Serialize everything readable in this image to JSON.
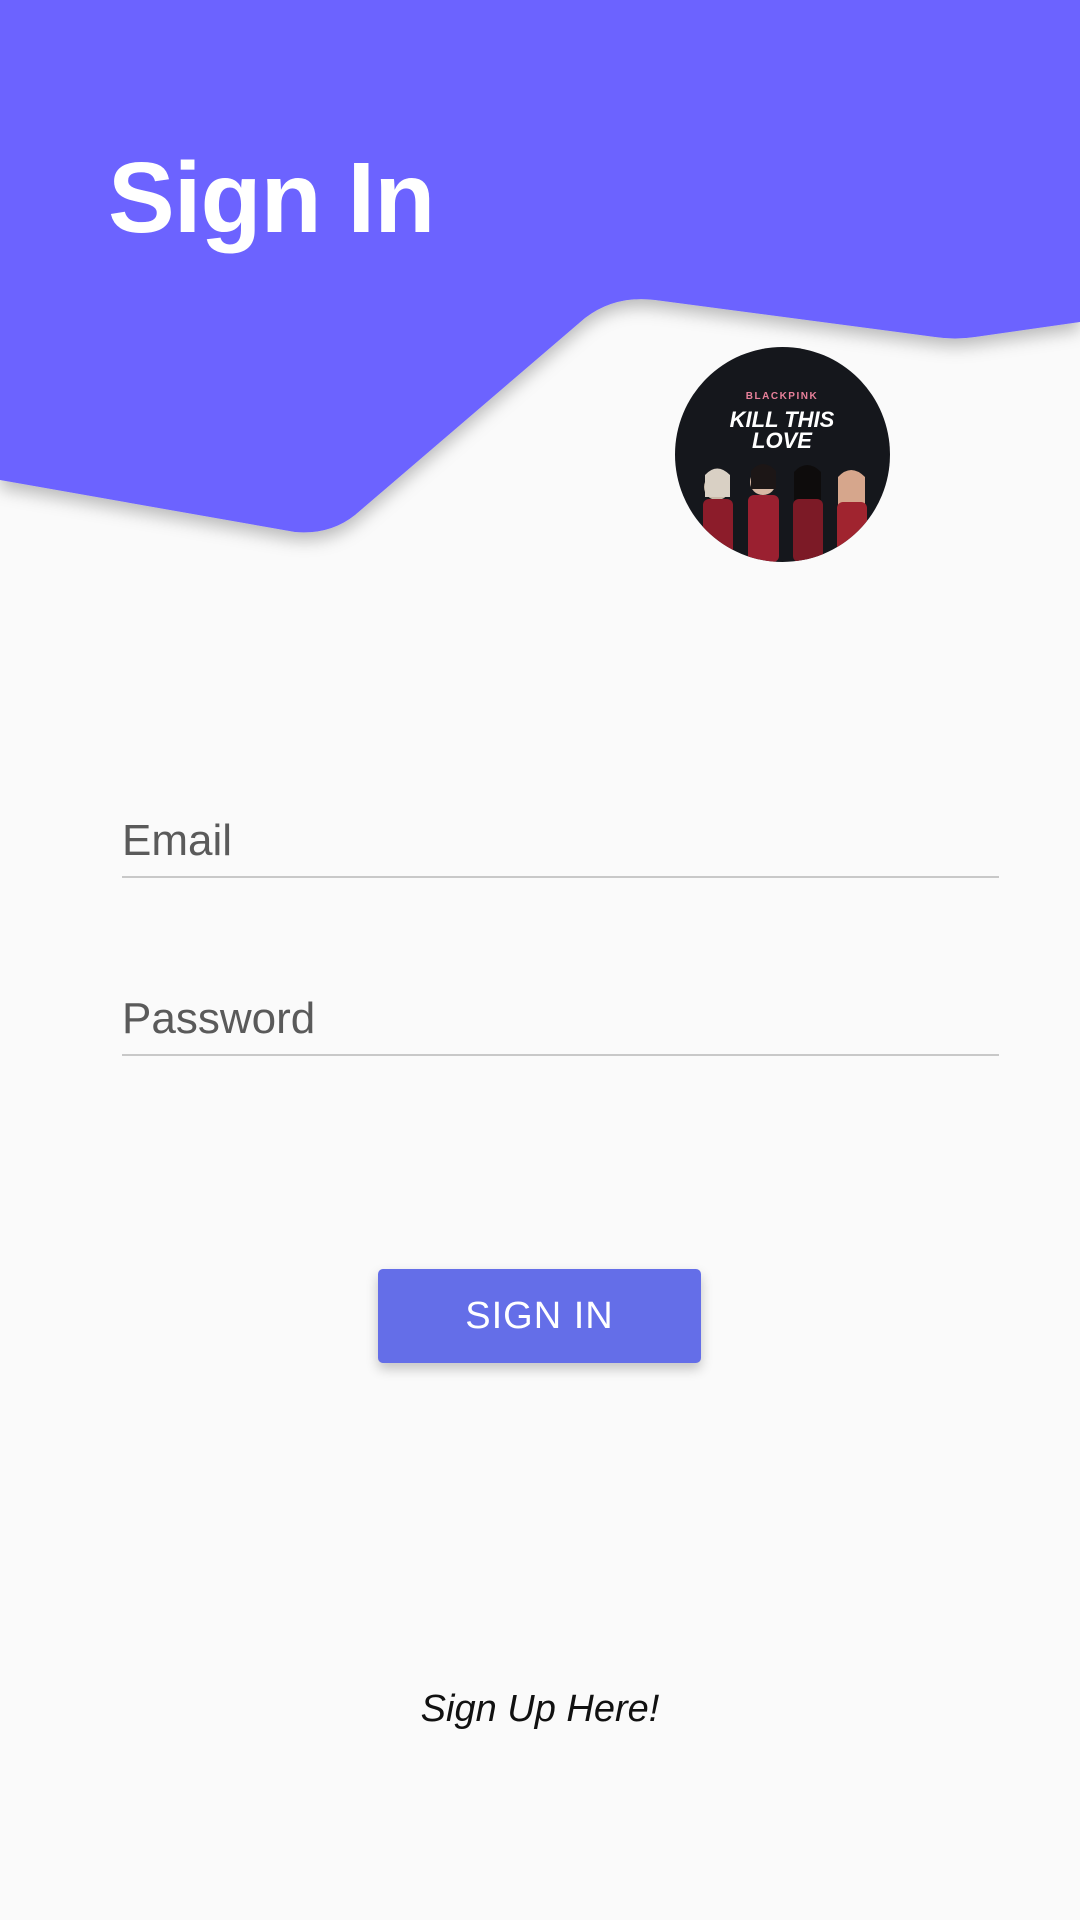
{
  "header": {
    "title": "Sign In",
    "background_color": "#6c63ff"
  },
  "avatar": {
    "brand_text": "BLACKPINK",
    "album_line1": "KILL THIS",
    "album_line2": "LOVE"
  },
  "form": {
    "email_placeholder": "Email",
    "password_placeholder": "Password",
    "submit_label": "SIGN IN"
  },
  "footer": {
    "signup_label": "Sign Up Here!"
  },
  "colors": {
    "accent": "#6c63ff",
    "button": "#646ee8",
    "background": "#fafafa"
  }
}
